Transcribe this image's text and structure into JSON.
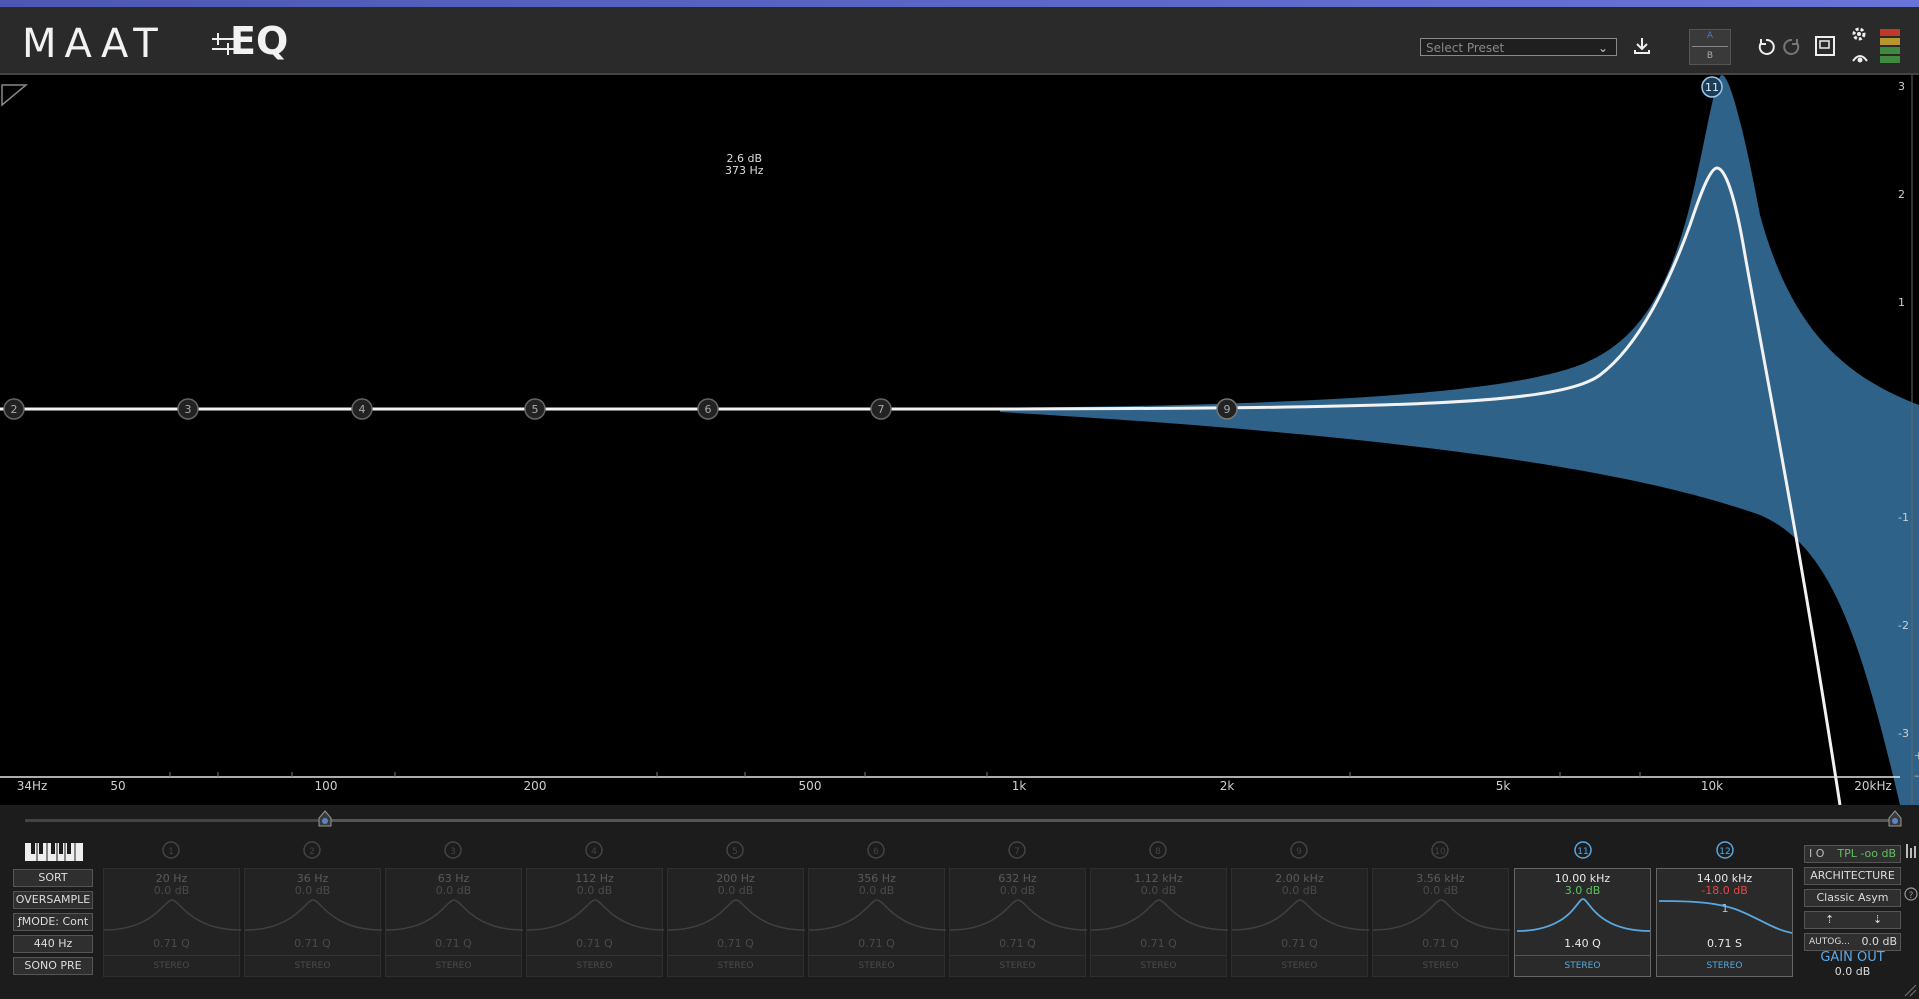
{
  "header": {
    "logo_text": "MAAT",
    "product_text": "EQ",
    "preset_placeholder": "Select Preset",
    "ab_top": "A",
    "ab_bottom": "B"
  },
  "graph": {
    "tooltip_gain": "2.6 dB",
    "tooltip_freq": "373 Hz",
    "freq_labels": [
      "34Hz",
      "50",
      "100",
      "200",
      "500",
      "1k",
      "2k",
      "5k",
      "10k",
      "20kHz"
    ],
    "db_labels": [
      "3",
      "2",
      "1",
      "-1",
      "-2",
      "-3"
    ],
    "nodes": [
      "2",
      "3",
      "4",
      "5",
      "6",
      "7",
      "9",
      "11"
    ]
  },
  "left_buttons": {
    "sort": "SORT",
    "oversample": "OVERSAMPLE",
    "fmode": "ƒMODE: Cont",
    "ref": "440 Hz",
    "sono": "SONO PRE"
  },
  "bands": [
    {
      "num": "1",
      "freq": "20 Hz",
      "gain": "0.0 dB",
      "q": "0.71 Q",
      "mode": "STEREO"
    },
    {
      "num": "2",
      "freq": "36 Hz",
      "gain": "0.0 dB",
      "q": "0.71 Q",
      "mode": "STEREO"
    },
    {
      "num": "3",
      "freq": "63 Hz",
      "gain": "0.0 dB",
      "q": "0.71 Q",
      "mode": "STEREO"
    },
    {
      "num": "4",
      "freq": "112 Hz",
      "gain": "0.0 dB",
      "q": "0.71 Q",
      "mode": "STEREO"
    },
    {
      "num": "5",
      "freq": "200 Hz",
      "gain": "0.0 dB",
      "q": "0.71 Q",
      "mode": "STEREO"
    },
    {
      "num": "6",
      "freq": "356 Hz",
      "gain": "0.0 dB",
      "q": "0.71 Q",
      "mode": "STEREO"
    },
    {
      "num": "7",
      "freq": "632 Hz",
      "gain": "0.0 dB",
      "q": "0.71 Q",
      "mode": "STEREO"
    },
    {
      "num": "8",
      "freq": "1.12 kHz",
      "gain": "0.0 dB",
      "q": "0.71 Q",
      "mode": "STEREO"
    },
    {
      "num": "9",
      "freq": "2.00 kHz",
      "gain": "0.0 dB",
      "q": "0.71 Q",
      "mode": "STEREO"
    },
    {
      "num": "10",
      "freq": "3.56 kHz",
      "gain": "0.0 dB",
      "q": "0.71 Q",
      "mode": "STEREO"
    },
    {
      "num": "11",
      "freq": "10.00 kHz",
      "gain": "3.0 dB",
      "q": "1.40 Q",
      "mode": "STEREO"
    },
    {
      "num": "12",
      "freq": "14.00 kHz",
      "gain": "-18.0 dB",
      "q": "0.71 S",
      "mode": "STEREO",
      "shelf_label": "1"
    }
  ],
  "right_panel": {
    "tpl": "TPL -oo dB",
    "architecture": "ARCHITECTURE",
    "arch_value": "Classic Asym",
    "autogain": "AUTOG...",
    "autogain_value": "0.0 dB",
    "gain_out_label": "GAIN OUT",
    "gain_out_value": "0.0 dB"
  },
  "colors": {
    "accent_blue": "#58a8e0",
    "fill_blue": "#2e6288",
    "positive": "#5fc05f",
    "negative": "#e24747"
  }
}
